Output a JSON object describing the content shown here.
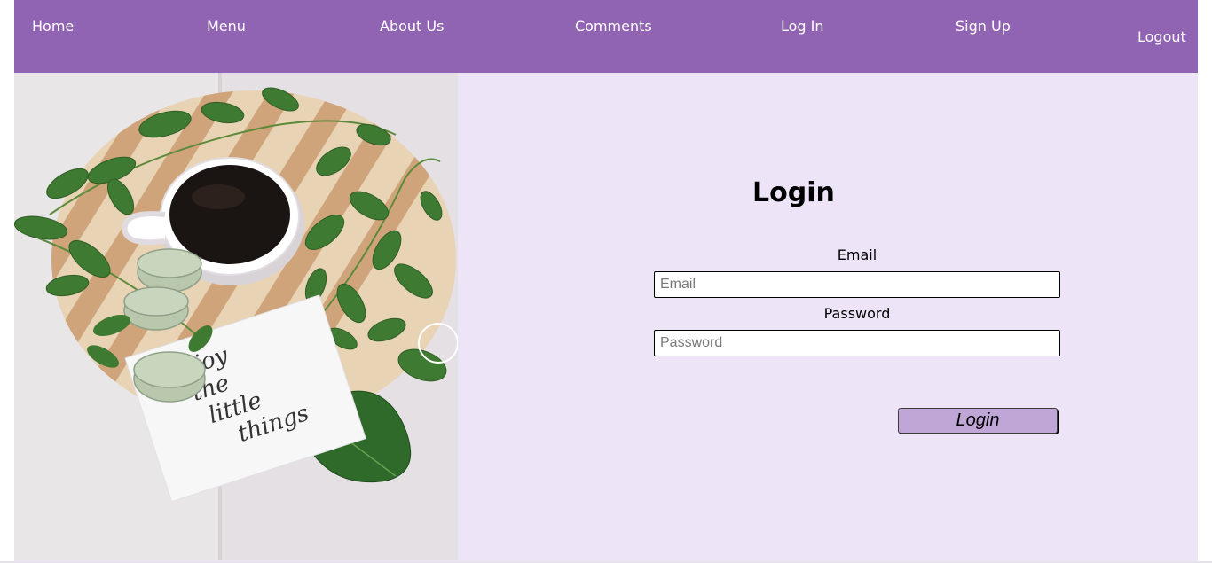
{
  "nav": {
    "home": "Home",
    "menu": "Menu",
    "about": "About Us",
    "comments": "Comments",
    "login": "Log In",
    "signup": "Sign Up",
    "logout": "Logout"
  },
  "hero_image": {
    "description_icon": "coffee-photo",
    "note_text": [
      "enjoy",
      "the",
      "little",
      "things"
    ]
  },
  "login_form": {
    "title": "Login",
    "email_label": "Email",
    "email_placeholder": "Email",
    "email_value": "",
    "password_label": "Password",
    "password_placeholder": "Password",
    "password_value": "",
    "submit_label": "Login"
  },
  "colors": {
    "navbar": "#9163b3",
    "content_bg": "#ede4f7",
    "button_bg": "#c0a6d6"
  }
}
